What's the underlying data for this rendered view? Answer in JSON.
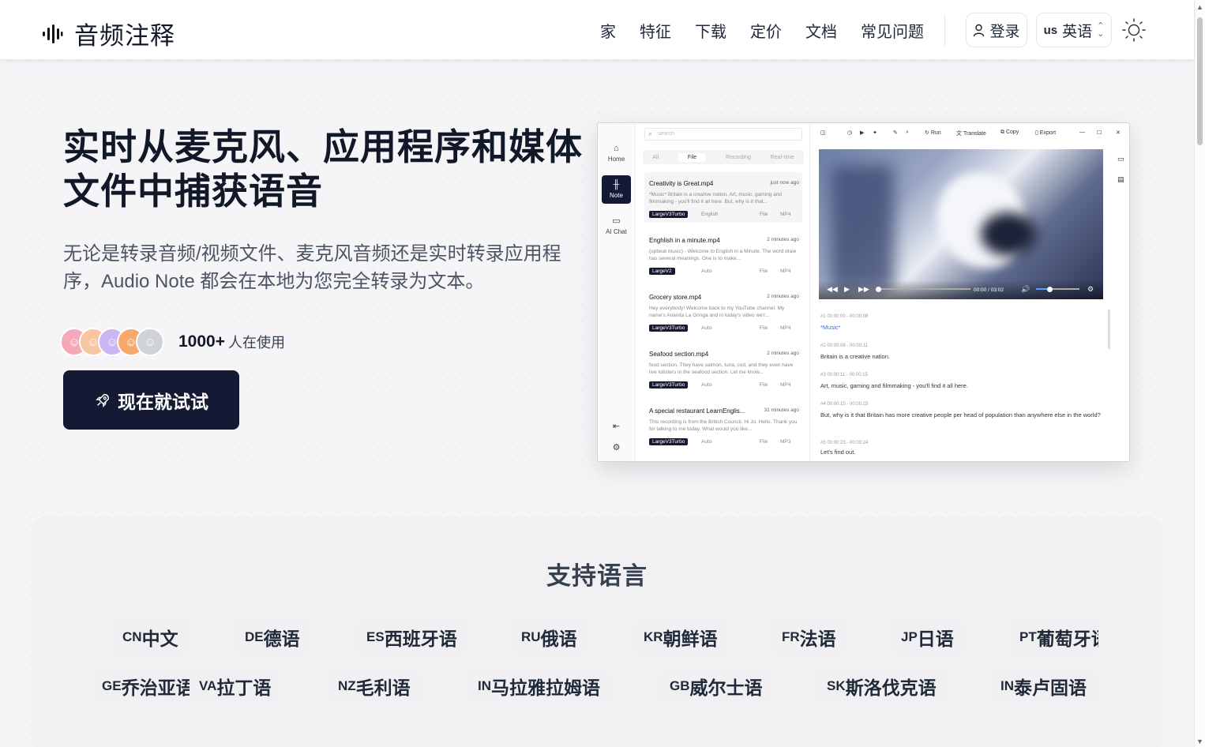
{
  "header": {
    "brand": "音频注释",
    "nav": [
      "家",
      "特征",
      "下载",
      "定价",
      "文档",
      "常见问题"
    ],
    "login": "登录",
    "lang_code": "us",
    "lang_label": "英语"
  },
  "hero": {
    "title_line1": "实时从麦克风、应用程序和媒体",
    "title_line2": "文件中捕获语音",
    "subtitle": "无论是转录音频/视频文件、麦克风音频还是实时转录应用程序，Audio Note 都会在本地为您完全转录为文本。",
    "users_count": "1000+",
    "users_text": "人在使用",
    "cta": "现在就试试"
  },
  "app": {
    "sidebar": [
      {
        "label": "Home",
        "icon": "home-icon"
      },
      {
        "label": "Note",
        "icon": "waveform-icon"
      },
      {
        "label": "AI Chat",
        "icon": "chat-icon"
      }
    ],
    "search_placeholder": "search",
    "tabs": [
      "All",
      "File",
      "Recording",
      "Real-time"
    ],
    "toolbar": [
      "Run",
      "Translate",
      "Copy",
      "Export"
    ],
    "records": [
      {
        "title": "Creativity is Great.mp4",
        "time": "just now ago",
        "snippet": "*Music* Britain is a creative nation. Art, music, gaming and filmmaking - you'll find it all here. But, why is it that...",
        "model": "LargeV3Turbo",
        "lang": "English",
        "type": "File",
        "ext": "MP4"
      },
      {
        "title": "Enghlish in a minute.mp4",
        "time": "2 minutes ago",
        "snippet": "(upbeat music) - Welcome to English in a Minute. The word draw has several meanings. One is to make...",
        "model": "LargeV2",
        "lang": "Auto",
        "type": "File",
        "ext": "MP4"
      },
      {
        "title": "Grocery store.mp4",
        "time": "2 minutes ago",
        "snippet": "Hey everybody! Welcome back to my YouTube channel. My name's Arianita La Gringa and in today's video we'r...",
        "model": "LargeV3Turbo",
        "lang": "Auto",
        "type": "File",
        "ext": "MP4"
      },
      {
        "title": "Seafood section.mp4",
        "time": "2 minutes ago",
        "snippet": "food section. They have salmon, tuna, cod, and they even have live lobsters in the seafood section. Let me know...",
        "model": "LargeV3Turbo",
        "lang": "Auto",
        "type": "File",
        "ext": "MP4"
      },
      {
        "title": "A special restaurant LearnEnglis...",
        "time": "31 minutes ago",
        "snippet": "This recording is from the British Council. Hi Jo. Hello. Thank you for talking to me today. What would you like...",
        "model": "LargeV3Turbo",
        "lang": "Auto",
        "type": "File",
        "ext": "MP3"
      }
    ],
    "player": {
      "current": "00:00",
      "duration": "03:02"
    },
    "segments": [
      {
        "meta": "#1  00:00:00 - 00:00:08",
        "text": "*Music*",
        "highlight": true
      },
      {
        "meta": "#2  00:00:08 - 00:00:11",
        "text": "Britain is a creative nation."
      },
      {
        "meta": "#3  00:00:11 - 00:00:15",
        "text": "Art, music, gaming and filmmaking - you'll find it all here."
      },
      {
        "meta": "#4  00:00:15 - 00:00:23",
        "text": "But, why is it that Britain has more creative people per head of population than anywhere else in the world?"
      },
      {
        "meta": "#5  00:00:23 - 00:00:24",
        "text": "Let's find out."
      }
    ]
  },
  "languages": {
    "heading": "支持语言",
    "items": [
      {
        "code": "CN",
        "name": "中文"
      },
      {
        "code": "DE",
        "name": "德语"
      },
      {
        "code": "ES",
        "name": "西班牙语"
      },
      {
        "code": "RU",
        "name": "俄语"
      },
      {
        "code": "KR",
        "name": "朝鲜语"
      },
      {
        "code": "FR",
        "name": "法语"
      },
      {
        "code": "JP",
        "name": "日语"
      },
      {
        "code": "PT",
        "name": "葡萄牙语"
      },
      {
        "code": "GE",
        "name": "乔治亚语"
      },
      {
        "code": "VA",
        "name": "拉丁语"
      },
      {
        "code": "NZ",
        "name": "毛利语"
      },
      {
        "code": "IN",
        "name": "马拉雅拉姆语"
      },
      {
        "code": "GB",
        "name": "威尔士语"
      },
      {
        "code": "SK",
        "name": "斯洛伐克语"
      },
      {
        "code": "IN",
        "name": "泰卢固语"
      }
    ]
  }
}
